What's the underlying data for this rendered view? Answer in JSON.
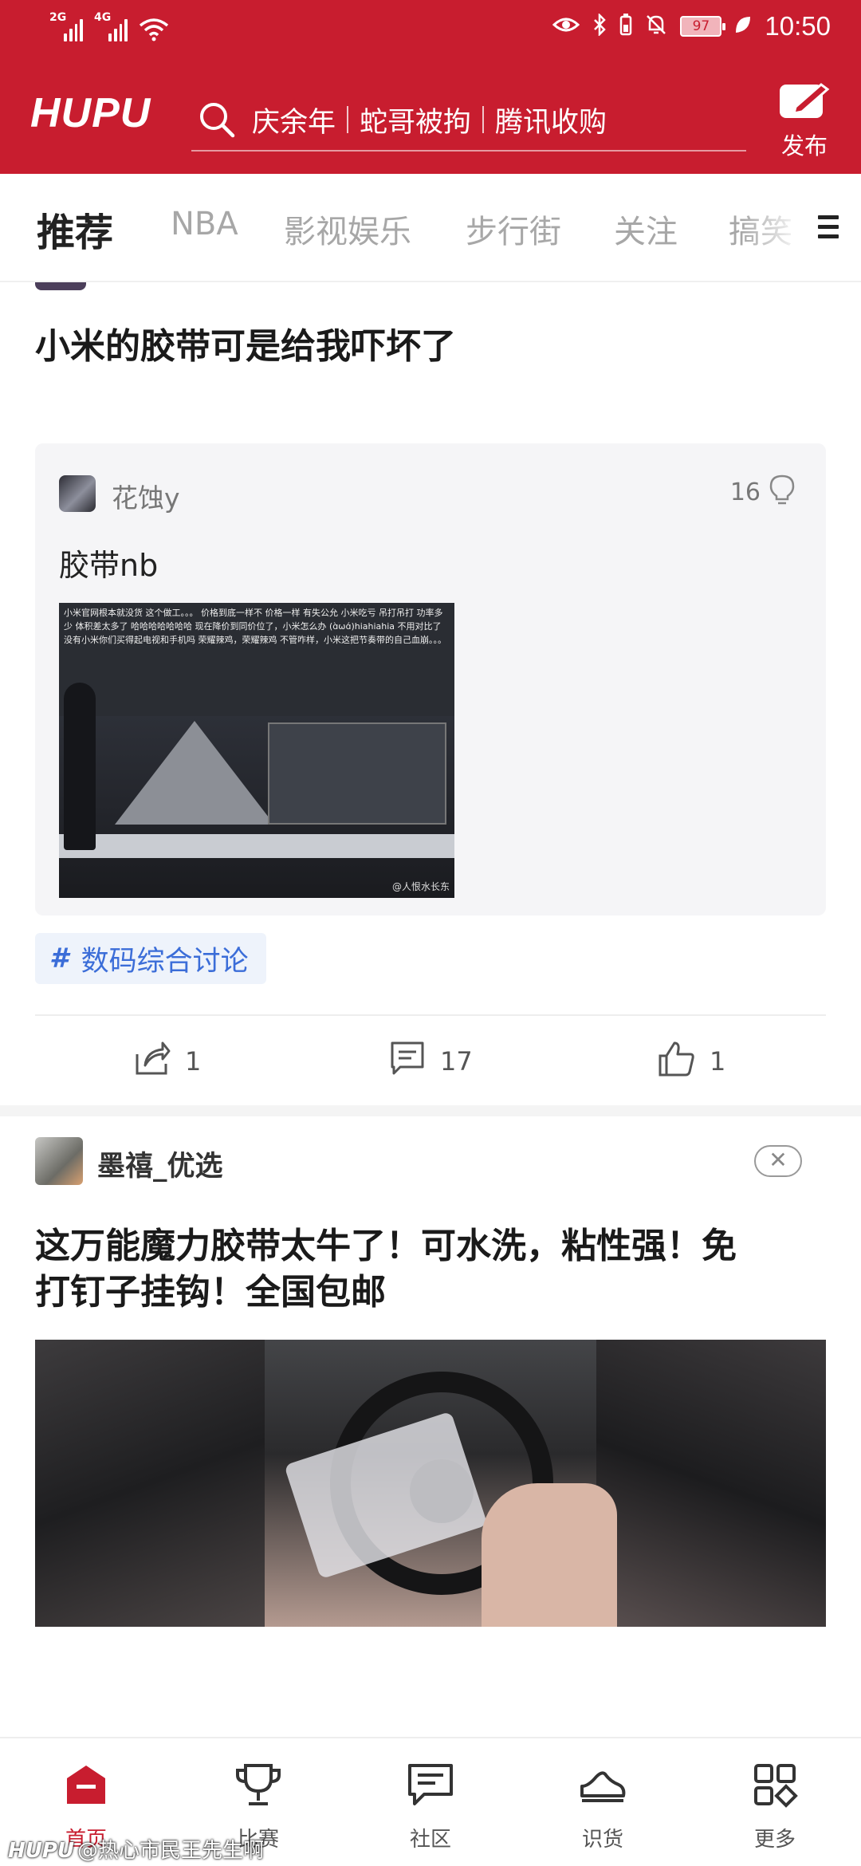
{
  "status_bar": {
    "signal_1": "2G",
    "signal_2": "4G",
    "battery": "97",
    "time": "10:50"
  },
  "header": {
    "logo": "HUPU",
    "search_terms": [
      "庆余年",
      "蛇哥被拘",
      "腾讯收购"
    ],
    "publish_label": "发布",
    "accent_color": "#c81d2f"
  },
  "tabs": {
    "items": [
      "推荐",
      "NBA",
      "影视娱乐",
      "步行街",
      "关注",
      "搞笑"
    ],
    "active": "推荐"
  },
  "post1": {
    "title": "小米的胶带可是给我吓坏了",
    "quote": {
      "user": "花蚀y",
      "likes": "16",
      "text": "胶带nb",
      "image_caption": "小米官网根本就没货 这个做工。。。 价格到底一样不 价格一样 有失公允 小米吃亏 吊打吊打 功率多少 体积差太多了 哈哈哈哈哈哈哈 现在降价到同价位了，小米怎么办 (ɑ̀ωɑ́)hiahiahia 不用对比了 没有小米你们买得起电视和手机吗 荣耀辣鸡，荣耀辣鸡 不管咋样，小米这把节奏带的自己血崩。。。",
      "image_watermark": "@人恨水长东"
    },
    "topic": "数码综合讨论",
    "shares": "1",
    "comments": "17",
    "likes": "1"
  },
  "ad": {
    "name": "墨禧_优选",
    "close_label": "✕",
    "title_line1": "这万能魔力胶带太牛了！可水洗，粘性强！免",
    "title_line2": "打钉子挂钩！全国包邮"
  },
  "bottom_nav": {
    "items": [
      "首页",
      "比赛",
      "社区",
      "识货",
      "更多"
    ],
    "active": "首页"
  },
  "watermark": {
    "brand": "HUPU",
    "text": "@热心市民王先生啊"
  }
}
